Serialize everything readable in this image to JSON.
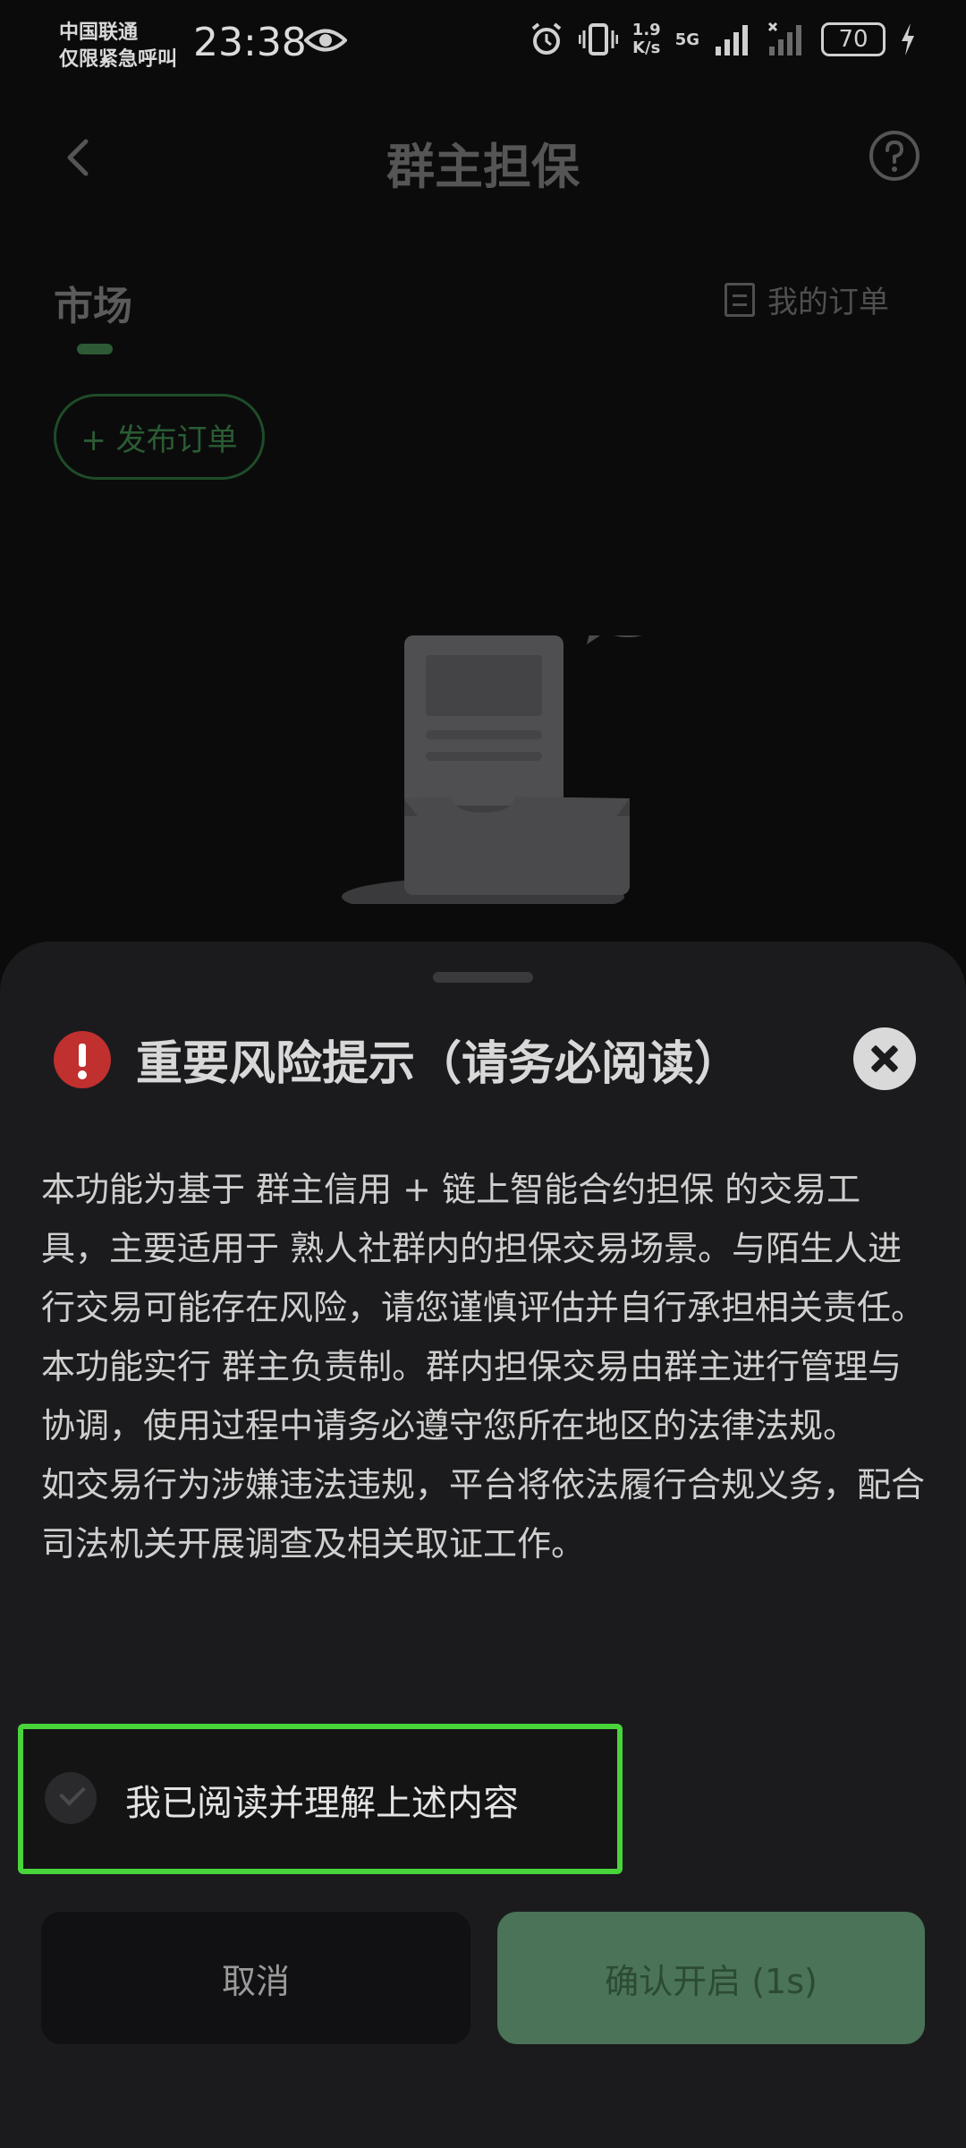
{
  "status_bar": {
    "carrier_line1": "中国联通",
    "carrier_line2": "仅限紧急呼叫",
    "time": "23:38",
    "net_speed_value": "1.9",
    "net_speed_unit": "K/s",
    "network": "5G",
    "battery": "70"
  },
  "page": {
    "title": "群主担保",
    "tab_market": "市场",
    "my_orders": "我的订单",
    "publish_button": "+ 发布订单"
  },
  "dialog": {
    "title": "重要风险提示（请务必阅读）",
    "paragraphs": [
      "本功能为基于 群主信用 + 链上智能合约担保 的交易工具，主要适用于 熟人社群内的担保交易场景。与陌生人进行交易可能存在风险，请您谨慎评估并自行承担相关责任。",
      "本功能实行 群主负责制。群内担保交易由群主进行管理与协调，使用过程中请务必遵守您所在地区的法律法规。",
      "如交易行为涉嫌违法违规，平台将依法履行合规义务，配合司法机关开展调查及相关取证工作。"
    ],
    "agree_label": "我已阅读并理解上述内容",
    "agree_checked": false,
    "cancel_button": "取消",
    "confirm_button": "确认开启 (1s)"
  },
  "colors": {
    "accent_green": "#4a7357",
    "warning_red": "#c0302f",
    "highlight_outline": "#48d43a"
  }
}
